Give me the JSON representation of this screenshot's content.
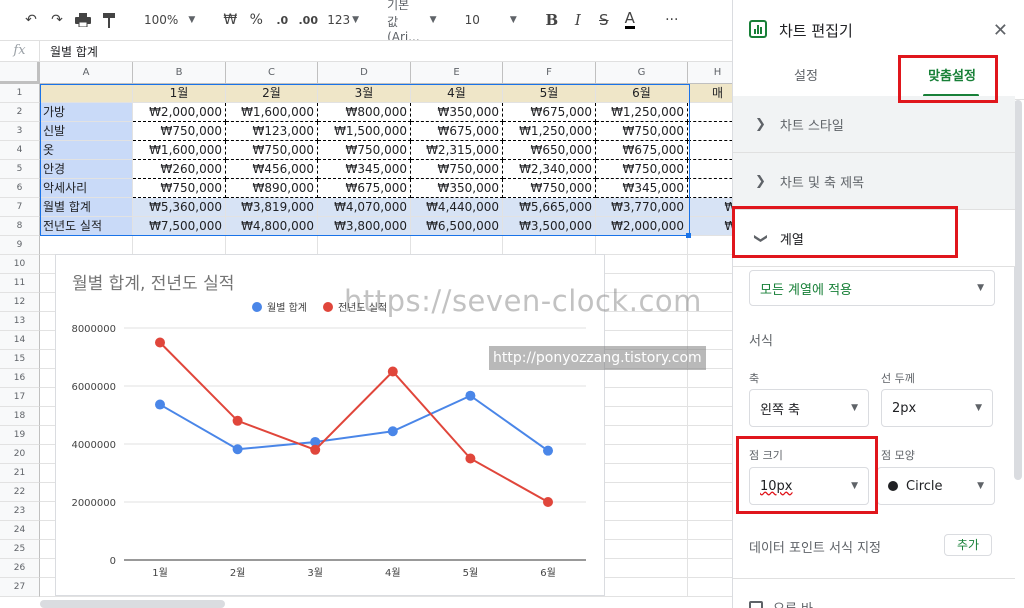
{
  "toolbar": {
    "zoom": "100%",
    "currency": "₩",
    "percent": "%",
    "dec_less": ".0",
    "dec_more": ".00",
    "num_format": "123",
    "font": "기본값 (Ari...",
    "font_size": "10",
    "bold": "B",
    "italic": "I",
    "strike": "S",
    "text_color": "A",
    "more": "···",
    "collapse": "⌃"
  },
  "formula_bar": {
    "fx": "fx",
    "value": "월별 합계"
  },
  "sheet": {
    "columns": [
      "A",
      "B",
      "C",
      "D",
      "E",
      "F",
      "G",
      "H"
    ],
    "rows": [
      "1",
      "2",
      "3",
      "4",
      "5",
      "6",
      "7",
      "8",
      "9",
      "10",
      "11",
      "12",
      "13",
      "14",
      "15",
      "16",
      "17",
      "18",
      "19",
      "20",
      "21",
      "22",
      "23",
      "24",
      "25",
      "26",
      "27"
    ],
    "header_row": [
      "",
      "1월",
      "2월",
      "3월",
      "4월",
      "5월",
      "6월",
      "매"
    ],
    "data_rows": [
      {
        "label": "가방",
        "values": [
          "₩2,000,000",
          "₩1,600,000",
          "₩800,000",
          "₩350,000",
          "₩675,000",
          "₩1,250,000",
          "₩"
        ]
      },
      {
        "label": "신발",
        "values": [
          "₩750,000",
          "₩123,000",
          "₩1,500,000",
          "₩675,000",
          "₩1,250,000",
          "₩750,000",
          "₩"
        ]
      },
      {
        "label": "옷",
        "values": [
          "₩1,600,000",
          "₩750,000",
          "₩750,000",
          "₩2,315,000",
          "₩650,000",
          "₩675,000",
          "₩"
        ]
      },
      {
        "label": "안경",
        "values": [
          "₩260,000",
          "₩456,000",
          "₩345,000",
          "₩750,000",
          "₩2,340,000",
          "₩750,000",
          "₩"
        ]
      },
      {
        "label": "악세사리",
        "values": [
          "₩750,000",
          "₩890,000",
          "₩675,000",
          "₩350,000",
          "₩750,000",
          "₩345,000",
          "₩"
        ]
      },
      {
        "label": "월별 합계",
        "values": [
          "₩5,360,000",
          "₩3,819,000",
          "₩4,070,000",
          "₩4,440,000",
          "₩5,665,000",
          "₩3,770,000",
          "₩7"
        ]
      },
      {
        "label": "전년도 실적",
        "values": [
          "₩7,500,000",
          "₩4,800,000",
          "₩3,800,000",
          "₩6,500,000",
          "₩3,500,000",
          "₩2,000,000",
          "₩2"
        ]
      }
    ]
  },
  "chart_data": {
    "type": "line",
    "title": "월별 합계, 전년도 실적",
    "categories": [
      "1월",
      "2월",
      "3월",
      "4월",
      "5월",
      "6월"
    ],
    "series": [
      {
        "name": "월별 합계",
        "color": "#4a86e8",
        "values": [
          5360000,
          3819000,
          4070000,
          4440000,
          5665000,
          3770000
        ]
      },
      {
        "name": "전년도 실적",
        "color": "#e0463b",
        "values": [
          7500000,
          4800000,
          3800000,
          6500000,
          3500000,
          2000000
        ]
      }
    ],
    "yticks": [
      "0",
      "2000000",
      "4000000",
      "6000000",
      "8000000"
    ],
    "ylim": [
      0,
      8000000
    ],
    "grid": true,
    "legend": "top"
  },
  "watermarks": {
    "main": "https://seven-clock.com",
    "secondary": "http://ponyozzang.tistory.com"
  },
  "panel": {
    "title": "차트 편집기",
    "close": "✕",
    "tabs": [
      "설정",
      "맞춤설정"
    ],
    "sections": [
      "차트 스타일",
      "차트 및 축 제목",
      "계열"
    ],
    "series_select": "모든 계열에 적용",
    "format_label": "서식",
    "axis_label": "축",
    "axis_value": "왼쪽 축",
    "line_width_label": "선 두께",
    "line_width_value": "2px",
    "point_size_label": "점 크기",
    "point_size_value": "10px",
    "point_shape_label": "점 모양",
    "point_shape_value": "Circle",
    "data_point_label": "데이터 포인트 서식 지정",
    "add_button": "추가",
    "bottom_item": "오류 바"
  },
  "colors": {
    "accent_green": "#188038",
    "highlight_red": "#e0161c"
  }
}
